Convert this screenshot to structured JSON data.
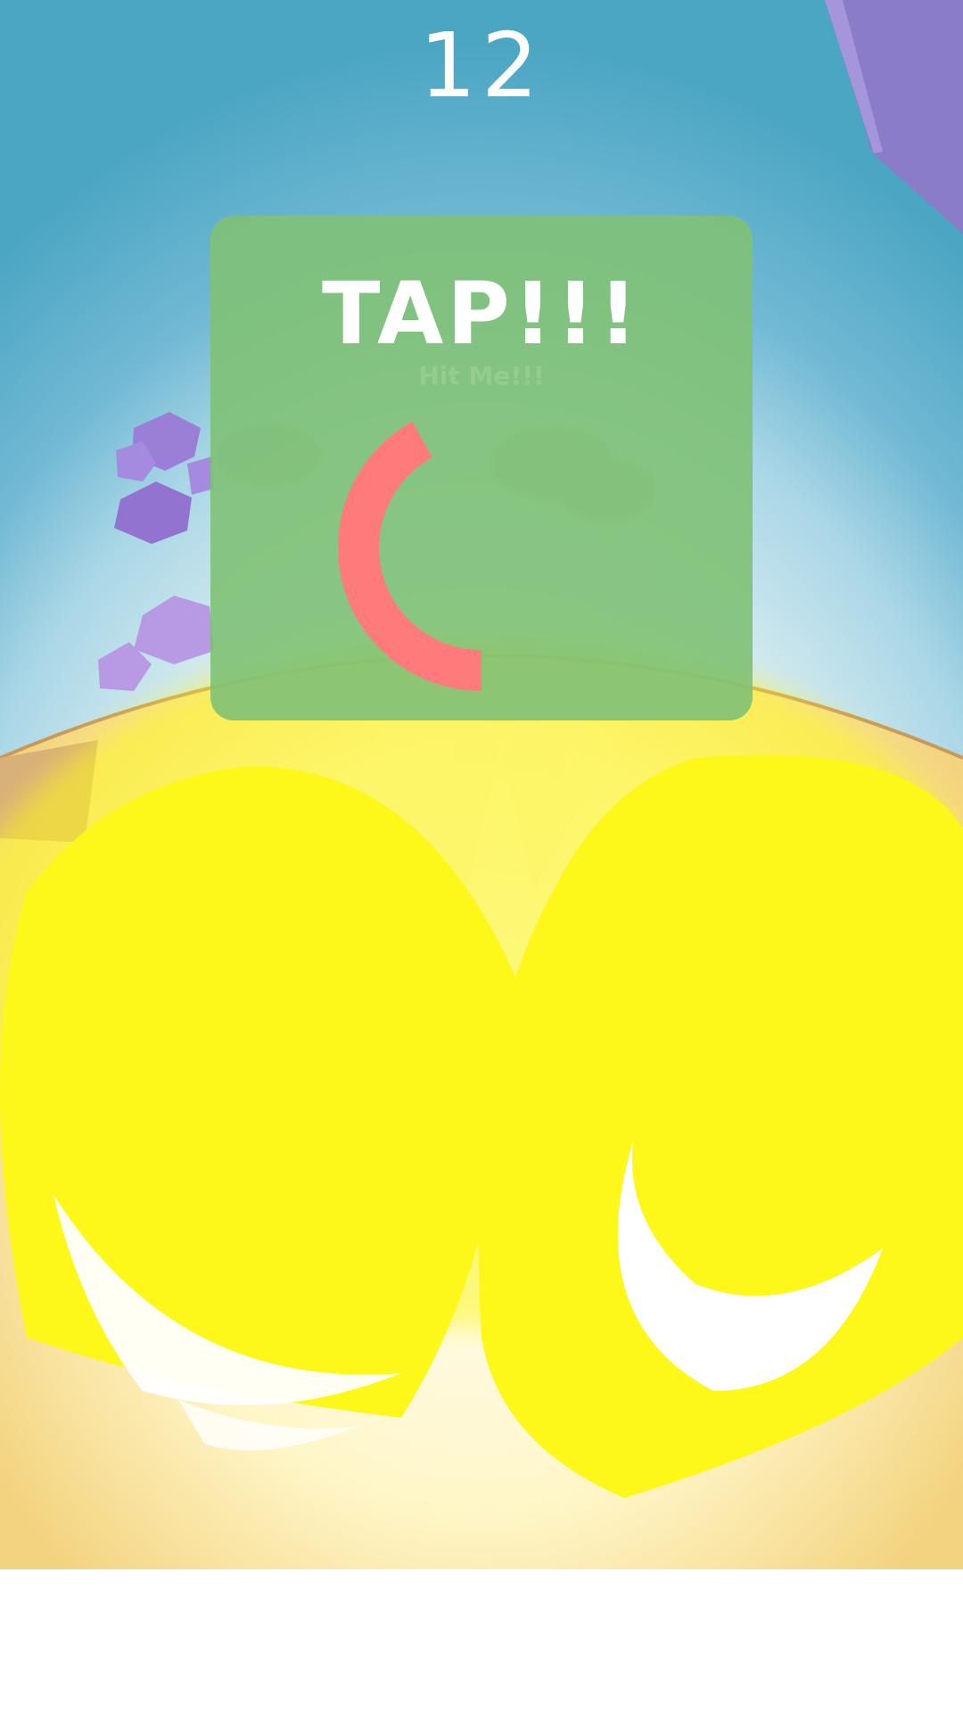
{
  "hud": {
    "score": "12"
  },
  "tap_prompt": {
    "title": "TAP!!!",
    "faded_label": "Hit Me!!!",
    "timer_remaining_fraction": 0.42,
    "timer_color": "#ff7b7b",
    "panel_color": "#80c176"
  },
  "palette": {
    "sky_top": "#4ba6c4",
    "sky_mid": "#a9d6e6",
    "glow": "#fdfbe8",
    "fruit_yellow": "#fdf71a",
    "crystal_purple": "#9b7fd6",
    "corner_purple": "#8a7cc9"
  },
  "icons": [
    "yellow-fruit-icon",
    "crystal-icon"
  ]
}
